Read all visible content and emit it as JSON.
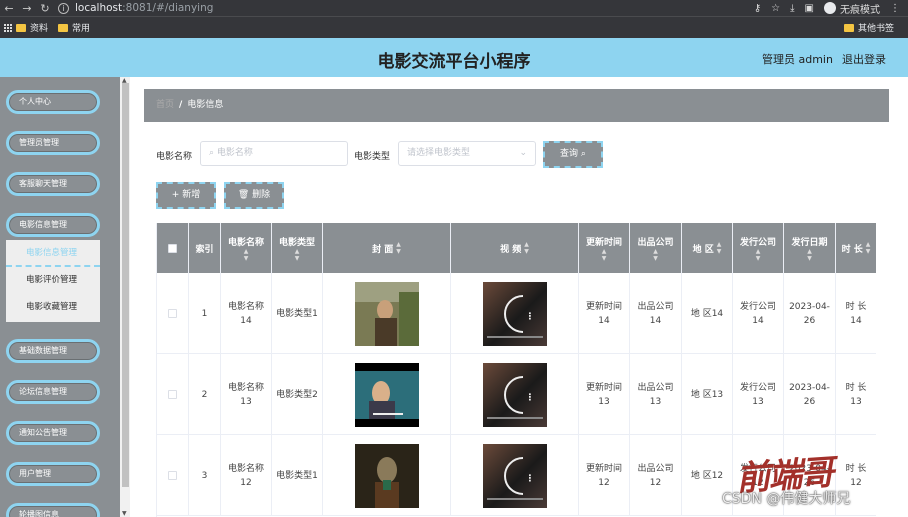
{
  "browser": {
    "url_host": "localhost",
    "url_path": ":8081/#/dianying",
    "profile_label": "无痕模式",
    "bookmarks": [
      "资料",
      "常用"
    ],
    "other_bookmarks": "其他书签"
  },
  "header": {
    "title": "电影交流平台小程序",
    "admin": "管理员 admin",
    "logout": "退出登录",
    "color": "#8ed4f0"
  },
  "sidebar": {
    "items": [
      "个人中心",
      "管理员管理",
      "客服聊天管理",
      "电影信息管理",
      "基础数据管理",
      "论坛信息管理",
      "通知公告管理",
      "用户管理",
      "轮播图信息"
    ],
    "sub_items": [
      "电影信息管理",
      "电影评价管理",
      "电影收藏管理"
    ]
  },
  "breadcrumb": {
    "home": "首页",
    "sep": "/",
    "current": "电影信息"
  },
  "search": {
    "name_label": "电影名称",
    "name_placeholder": "电影名称",
    "type_label": "电影类型",
    "type_placeholder": "请选择电影类型",
    "query_button": "查询"
  },
  "actions": {
    "add": "新增",
    "delete": "删除"
  },
  "table": {
    "headers": [
      "索引",
      "电影名称",
      "电影类型",
      "封 面",
      "视 频",
      "更新时间",
      "出品公司",
      "地 区",
      "发行公司",
      "发行日期",
      "时 长"
    ],
    "rows": [
      {
        "index": "1",
        "name": "电影名称14",
        "type": "电影类型1",
        "update": "更新时间14",
        "company": "出品公司14",
        "region": "地 区14",
        "publisher": "发行公司14",
        "date": "2023-04-26",
        "duration": "时 长14"
      },
      {
        "index": "2",
        "name": "电影名称13",
        "type": "电影类型2",
        "update": "更新时间13",
        "company": "出品公司13",
        "region": "地 区13",
        "publisher": "发行公司13",
        "date": "2023-04-26",
        "duration": "时 长13"
      },
      {
        "index": "3",
        "name": "电影名称12",
        "type": "电影类型1",
        "update": "更新时间12",
        "company": "出品公司12",
        "region": "地 区12",
        "publisher": "发行公司12",
        "date": "2023-04-26",
        "duration": "时 长12"
      }
    ]
  },
  "watermark": {
    "logo": "前端哥",
    "text": "CSDN @伟健大师兄"
  }
}
